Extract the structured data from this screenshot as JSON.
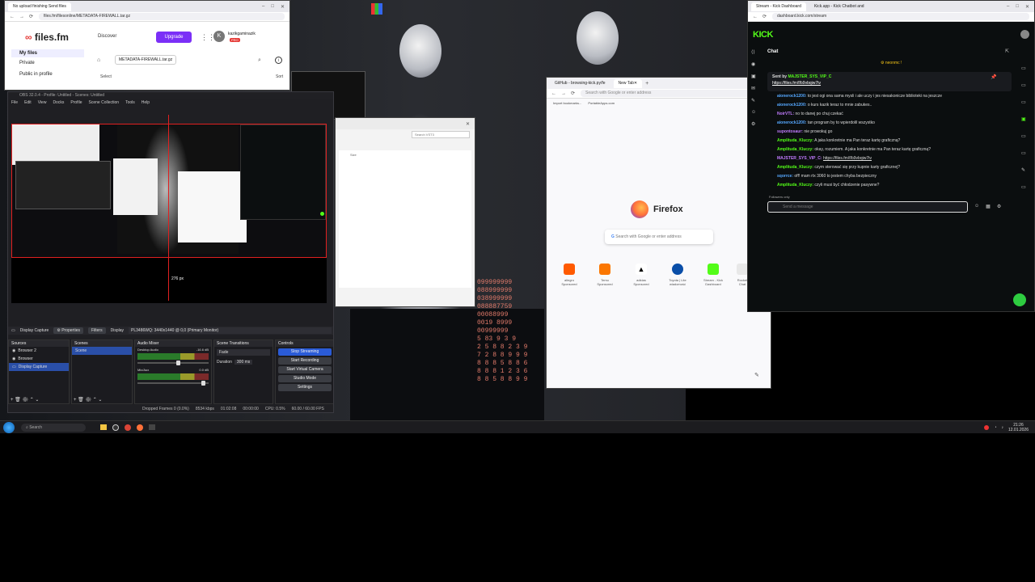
{
  "colors": {
    "accent_obs": "#2a5bd7",
    "kick_green": "#53fc18",
    "files_purple": "#7b2ff7",
    "firefox_orange": "#ff7139"
  },
  "filesfm": {
    "tab": "No upload finishing Send files",
    "url": "files.fm/filesonline/METADATA-FIREWALL.tar.gz",
    "logo": "files.fm",
    "discover": "Discover",
    "upgrade": "Upgrade",
    "user": "kazikgaminazik",
    "badge": "PRO",
    "avatar_letter": "K",
    "sidebar": [
      "My files",
      "Private",
      "Public in profile"
    ],
    "folder": "METADATA-FIREWALL.tar.gz",
    "select": "Select",
    "sort": "Sort"
  },
  "obs": {
    "title": "OBS 32.0.4 - Profile: Untitled - Scenes: Untitled",
    "menu": [
      "File",
      "Edit",
      "View",
      "Docks",
      "Profile",
      "Scene Collection",
      "Tools",
      "Help"
    ],
    "canvas_size": "276 px",
    "source_name": "Display Capture",
    "properties": "Properties",
    "filters": "Filters",
    "display_label": "Display",
    "display_value": "PL3486WQ: 3440x1440 @ 0,0 (Primary Monitor)",
    "docks": {
      "sources": "Sources",
      "scenes": "Scenes",
      "mixer": "Audio Mixer",
      "transitions": "Scene Transitions",
      "controls": "Controls"
    },
    "sources": [
      "Browser 2",
      "Browser",
      "Display Capture"
    ],
    "scenes": [
      "Scene"
    ],
    "mixer": [
      {
        "name": "Desktop Audio",
        "db": "-16.6 dB"
      },
      {
        "name": "Mic/Aux",
        "db": "0.0 dB"
      }
    ],
    "transition": "Fade",
    "duration_label": "Duration",
    "duration": "300 ms",
    "controls": [
      "Stop Streaming",
      "Start Recording",
      "Start Virtual Camera",
      "Studio Mode",
      "Settings"
    ],
    "status": {
      "dropped": "Dropped Frames 0 (0.0%)",
      "kbps": "8534 kbps",
      "time": "01:02:08",
      "rec": "00:00:00",
      "cpu": "CPU: 0.5%",
      "fps": "60.00 / 60.00 FPS"
    }
  },
  "firefox": {
    "tabs": [
      "GitHub - browsing-kick.py/fe",
      "New Tab"
    ],
    "url_placeholder": "Search with Google or enter address",
    "bookmarks": [
      "Import bookmarks...",
      "PortableApps.com"
    ],
    "brand": "Firefox",
    "search_placeholder": "Search with Google or enter address",
    "tiles": [
      {
        "label": "allegro",
        "sub": "Sponsored",
        "color": "#ff5a00"
      },
      {
        "label": "Temu",
        "sub": "Sponsored",
        "color": "#fb7701"
      },
      {
        "label": "adidas",
        "sub": "Sponsored",
        "color": "#ffffff"
      },
      {
        "label": "Toyota | Lite",
        "sub": "wiadomość",
        "color": "#0a4ea8"
      },
      {
        "label": "Stream - Kick",
        "sub": "Dashboard",
        "color": "#53fc18"
      },
      {
        "label": "Rocket",
        "sub": "Chat",
        "color": "#e8e8e8"
      }
    ]
  },
  "explorer": {
    "search": "Search VST3",
    "col": "Size"
  },
  "kick": {
    "tabs": [
      "Stream - Kick Dashboard",
      "Kick.app - Kick Chatbot and"
    ],
    "url": "dashboard.kick.com/stream",
    "logo": "KICK",
    "chat_title": "Chat",
    "pinned_user": "neonmc",
    "sent_by": "Sent by",
    "pinned_sender": "MAJSTER_SYS_VIP_C",
    "pinned_link": "https://files.fm/f/b9vbqiw7tv",
    "messages": [
      {
        "user": "aionerock1200:",
        "text": "to jest ogi ona sama mysli i ale uczy i jes niesakonicze biblioteki na jeszcze",
        "cls": "uname-b"
      },
      {
        "user": "aionerock1200:",
        "text": "o kurs kazik teraz to mnie zabukes..",
        "cls": "uname-b"
      },
      {
        "user": "NoirVTL:",
        "text": "no to danej po chuj czekać",
        "cls": "uname-p"
      },
      {
        "user": "aionerock1200:",
        "text": "tan program by to wpierdolil wszystko",
        "cls": "uname-b"
      },
      {
        "user": "supontosaur:",
        "text": "nie prowokuj go",
        "cls": "uname-p"
      },
      {
        "user": "Amplituda_Kluczy:",
        "text": "A jaka konkretnie ma Pan teraz kartę graficzną?",
        "cls": "uname-g"
      },
      {
        "user": "Amplituda_Kluczy:",
        "text": "okay, rozumiem. A jaka konkretnie ma Pan teraz kartę graficzną?",
        "cls": "uname-g"
      },
      {
        "user": "MAJSTER_SYS_VIP_C:",
        "text": "https://files.fm/f/b9vbqiw7tv",
        "cls": "uname-p"
      },
      {
        "user": "Amplituda_Kluczy:",
        "text": "czym sterować się przy kupnie karty graficznej?",
        "cls": "uname-g"
      },
      {
        "user": "sqorrce:",
        "text": "off! mam rtx 3060 to jestem chyba bezpieczny",
        "cls": "uname-b"
      },
      {
        "user": "Amplituda_Kluczy:",
        "text": "czyli musi być chłodzenie pasywne?",
        "cls": "uname-g"
      }
    ],
    "followers_only": "Followers only",
    "input_placeholder": "Send a message"
  },
  "taskbar": {
    "search": "Search",
    "time": "21:26",
    "date": "12.01.2026"
  }
}
